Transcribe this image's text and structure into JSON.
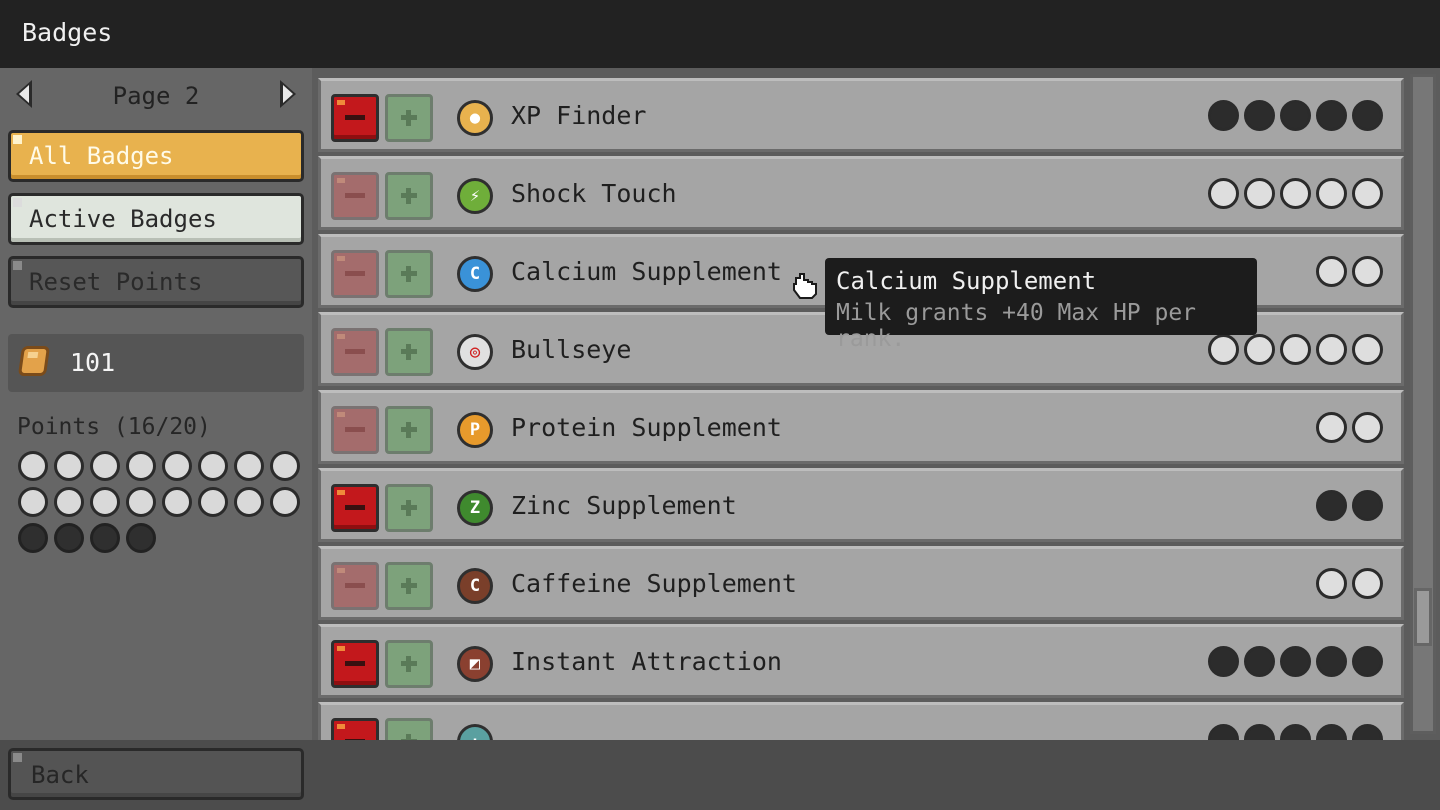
{
  "window": {
    "title": "Badges"
  },
  "sidebar": {
    "page_label": "Page 2",
    "buttons": {
      "all": "All Badges",
      "active": "Active Badges",
      "reset": "Reset Points"
    },
    "coins": "101",
    "points_label": "Points (16/20)",
    "points_total": 20,
    "points_used": 4
  },
  "badges": [
    {
      "name": "XP Finder",
      "icon": "xp-finder-icon",
      "icon_color": "#e8b24e",
      "icon_glyph": "●",
      "equipped": true,
      "ranks": 5,
      "filled": 5
    },
    {
      "name": "Shock Touch",
      "icon": "lightning-icon",
      "icon_color": "#6fae3a",
      "icon_glyph": "⚡",
      "equipped": false,
      "ranks": 5,
      "filled": 0
    },
    {
      "name": "Calcium Supplement",
      "icon": "calcium-icon",
      "icon_color": "#3a92d8",
      "icon_glyph": "C",
      "equipped": false,
      "ranks": 2,
      "filled": 0
    },
    {
      "name": "Bullseye",
      "icon": "target-icon",
      "icon_color": "#e0e0e0",
      "icon_glyph": "◎",
      "equipped": false,
      "ranks": 5,
      "filled": 0
    },
    {
      "name": "Protein Supplement",
      "icon": "protein-icon",
      "icon_color": "#e79a2c",
      "icon_glyph": "P",
      "equipped": false,
      "ranks": 2,
      "filled": 0
    },
    {
      "name": "Zinc Supplement",
      "icon": "zinc-icon",
      "icon_color": "#3f8a2e",
      "icon_glyph": "Z",
      "equipped": true,
      "ranks": 2,
      "filled": 2
    },
    {
      "name": "Caffeine Supplement",
      "icon": "caffeine-icon",
      "icon_color": "#7a3f2a",
      "icon_glyph": "C",
      "equipped": false,
      "ranks": 2,
      "filled": 0
    },
    {
      "name": "Instant Attraction",
      "icon": "magnet-icon",
      "icon_color": "#8a4030",
      "icon_glyph": "◩",
      "equipped": true,
      "ranks": 5,
      "filled": 5
    },
    {
      "name": "",
      "icon": "clover-icon",
      "icon_color": "#5aa0a0",
      "icon_glyph": "✚",
      "equipped": true,
      "ranks": 5,
      "filled": 5
    }
  ],
  "tooltip": {
    "title": "Calcium Supplement",
    "description": "Milk grants +40 Max HP per rank."
  },
  "footer": {
    "back_label": "Back"
  },
  "scroll_position": 0.78
}
